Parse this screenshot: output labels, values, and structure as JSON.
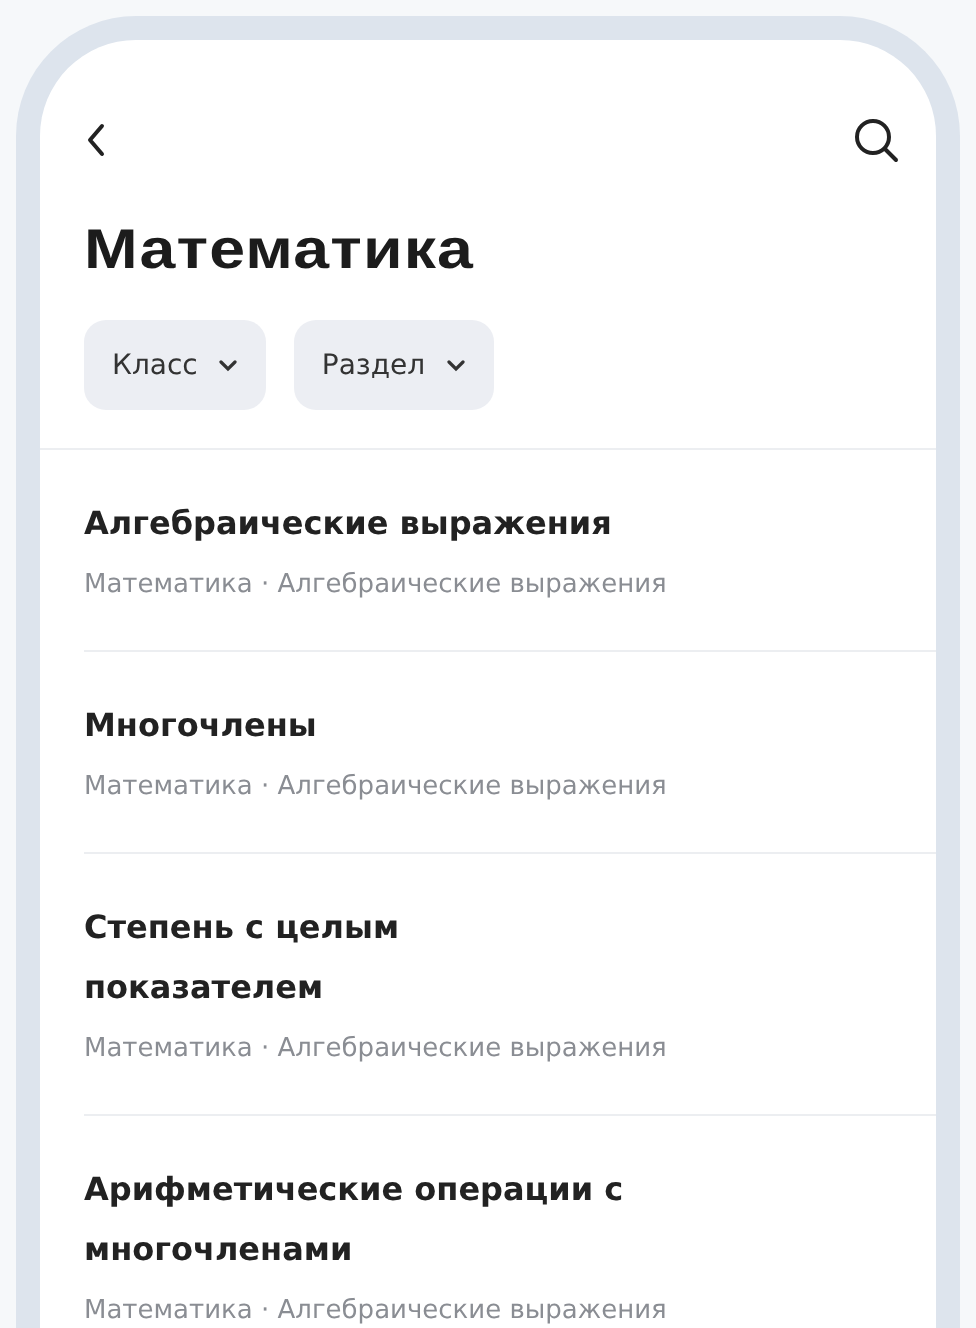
{
  "header": {
    "title": "Математика"
  },
  "filters": [
    {
      "label": "Класс"
    },
    {
      "label": "Раздел"
    }
  ],
  "topics": [
    {
      "title": "Алгебраические выражения",
      "path": "Математика · Алгебраические выражения"
    },
    {
      "title": "Многочлены",
      "path": "Математика · Алгебраические выражения"
    },
    {
      "title": "Степень с целым показателем",
      "path": "Математика · Алгебраические выражения"
    },
    {
      "title": "Арифметические операции с многочленами",
      "path": "Математика · Алгебраические выражения"
    }
  ]
}
